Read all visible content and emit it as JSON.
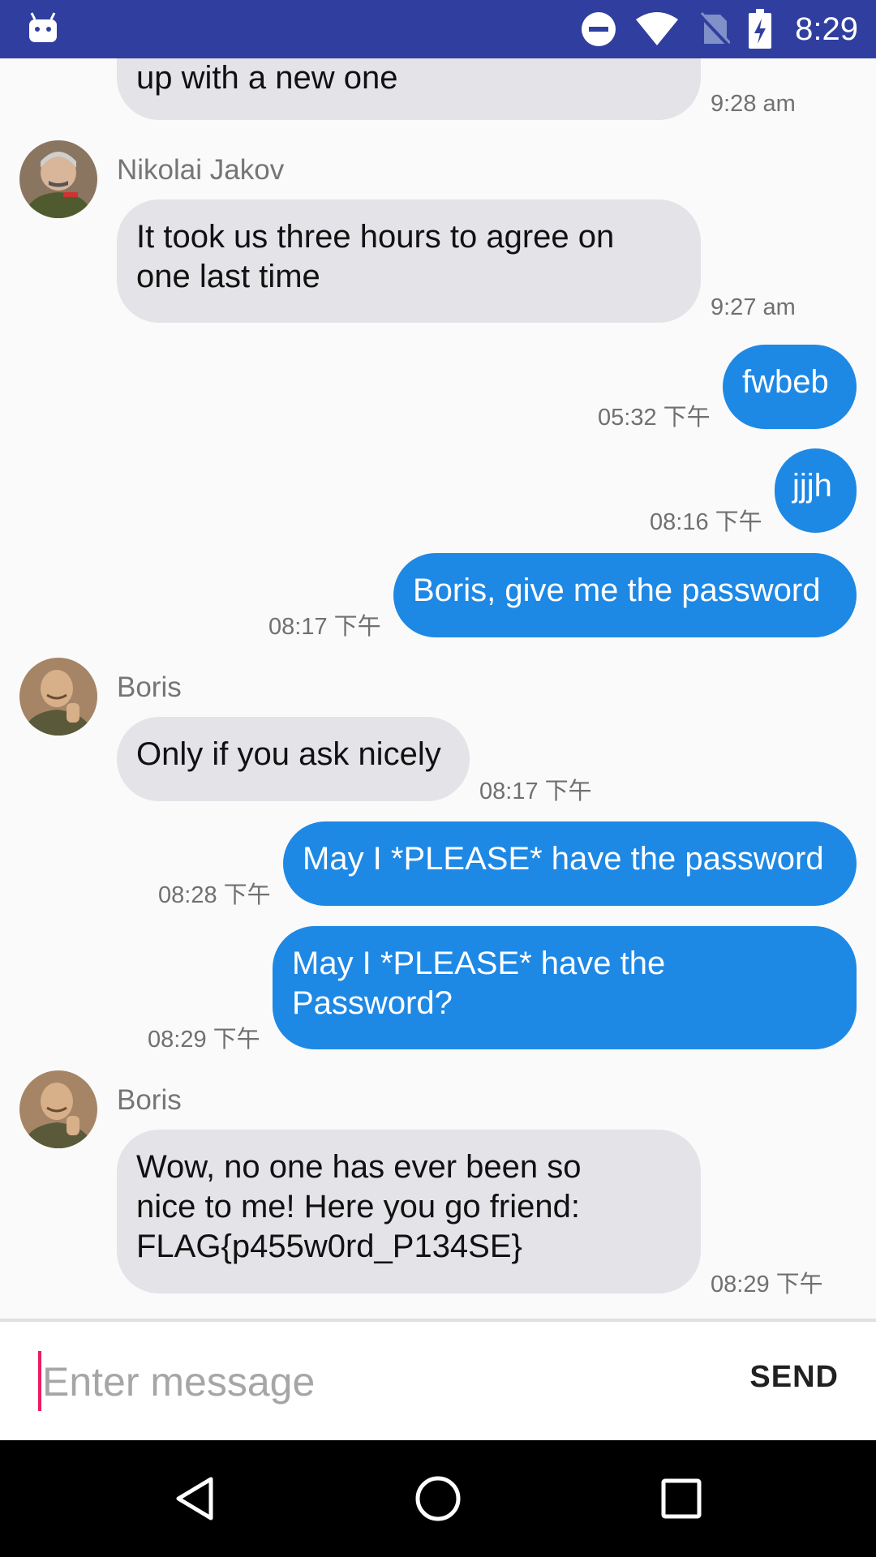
{
  "status_bar": {
    "time": "8:29",
    "icons": [
      "android-icon",
      "do-not-disturb-icon",
      "wifi-icon",
      "no-sim-icon",
      "battery-charging-icon"
    ]
  },
  "messages": [
    {
      "type": "incoming",
      "text": "up with a new one",
      "time": "9:28 am"
    },
    {
      "type": "incoming",
      "sender": "Nikolai Jakov",
      "text": "It took us three hours to agree on\none last time",
      "time": "9:27 am"
    },
    {
      "type": "outgoing",
      "text": "fwbeb",
      "time": "05:32 下午"
    },
    {
      "type": "outgoing",
      "text": "jjjh",
      "time": "08:16 下午"
    },
    {
      "type": "outgoing",
      "text": "Boris, give me the password",
      "time": "08:17 下午"
    },
    {
      "type": "incoming",
      "sender": "Boris",
      "text": "Only if you ask nicely",
      "time": "08:17 下午"
    },
    {
      "type": "outgoing",
      "text": "May I *PLEASE* have the password",
      "time": "08:28 下午"
    },
    {
      "type": "outgoing",
      "text": "May I *PLEASE* have the\nPassword?",
      "time": "08:29 下午"
    },
    {
      "type": "incoming",
      "sender": "Boris",
      "text": "Wow, no one has ever been so\nnice to me! Here you go friend:\nFLAG{p455w0rd_P134SE}",
      "time": "08:29 下午"
    }
  ],
  "composer": {
    "placeholder": "Enter message",
    "value": "",
    "send_label": "SEND"
  },
  "colors": {
    "status_bar": "#303f9f",
    "outgoing_bubble": "#1e88e5",
    "incoming_bubble": "#e3e3e8",
    "cursor": "#e91e63"
  }
}
